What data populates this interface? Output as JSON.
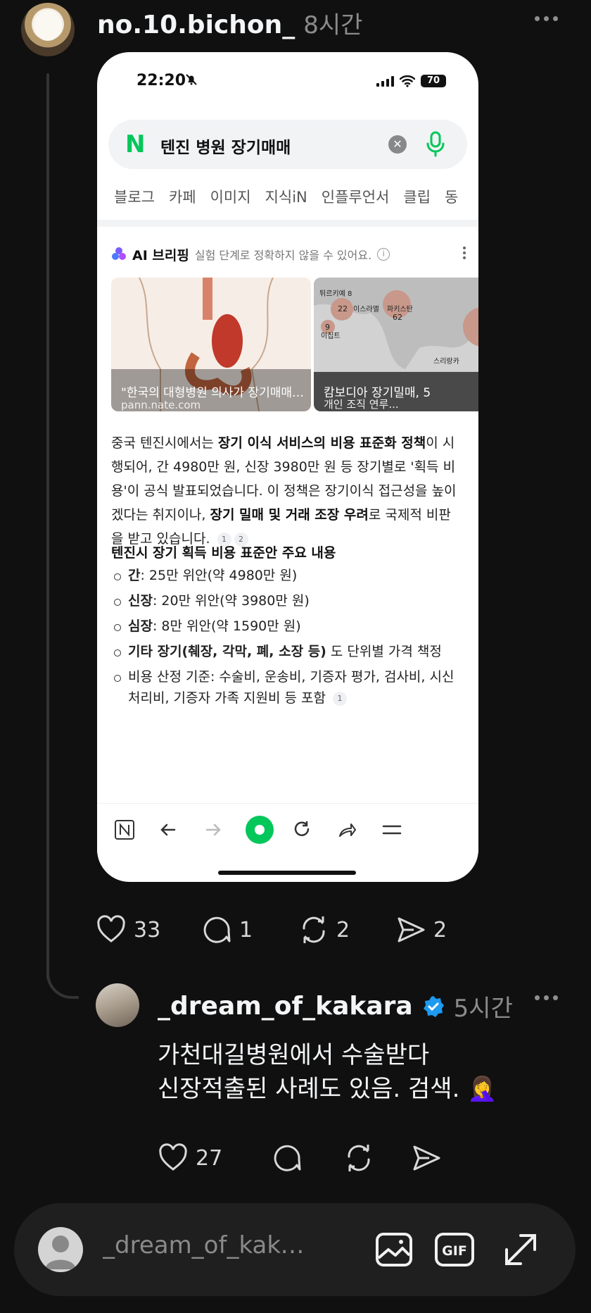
{
  "post": {
    "username": "no.10.bichon_",
    "time": "8시간",
    "likes": "33",
    "comments": "1",
    "reposts": "2",
    "shares": "2"
  },
  "screenshot": {
    "status_time": "22:20",
    "battery": "70",
    "search_query": "텐진 병원 장기매매",
    "tabs": [
      "블로그",
      "카페",
      "이미지",
      "지식iN",
      "인플루언서",
      "클립",
      "동"
    ],
    "ai_title": "AI 브리핑",
    "ai_note": "실험 단계로 정확하지 않을 수 있어요.",
    "image1_caption": "\"한국의 대형병원 의사가 장기매매 ...",
    "image1_source": "pann.nate.com",
    "image2_caption": "캄보디아 장기밀매, 5",
    "image2_source": "개인 조직 연루...",
    "map_labels": [
      "튀르키예 8",
      "22",
      "이스라엘",
      "파키스탄",
      "62",
      "9",
      "이집트",
      "스리랑카"
    ],
    "body_p1": "중국 텐진시에서는 ",
    "body_b1": "장기 이식 서비스의 비용 표준화 정책",
    "body_p2": "이 시행되어, 간 4980만 원, 신장 3980만 원 등 장기별로 '획득 비용'이 공식 발표되었습니다. 이 정책은 장기이식 접근성을 높이겠다는 취지이나, ",
    "body_b2": "장기 밀매 및 거래 조장 우려",
    "body_p3": "로 국제적 비판을 받고 있습니다.",
    "cite1": "1",
    "cite2": "2",
    "subtitle": "텐진시 장기 획득 비용 표준안 주요 내용",
    "bullets": [
      {
        "bold": "간",
        "text": ": 25만 위안(약 4980만 원)"
      },
      {
        "bold": "신장",
        "text": ": 20만 위안(약 3980만 원)"
      },
      {
        "bold": "심장",
        "text": ": 8만 위안(약 1590만 원)"
      },
      {
        "bold": "기타 장기(췌장, 각막, 폐, 소장 등)",
        "text": " 도 단위별 가격 책정"
      },
      {
        "bold": "",
        "text": "비용 산정 기준: 수술비, 운송비, 기증자 평가, 검사비, 시신 처리비, 기증자 가족 지원비 등 포함"
      }
    ],
    "bullet_cite": "1"
  },
  "reply": {
    "username": "_dream_of_kakara",
    "time": "5시간",
    "text_line1": "가천대길병원에서 수술받다",
    "text_line2": "신장적출된 사례도 있음. 검색. 🤦‍♀️",
    "likes": "27"
  },
  "composer": {
    "placeholder": "_dream_of_kakara..."
  },
  "colors": {
    "background": "#101010",
    "naver_green": "#03c75a",
    "verified_blue": "#1d9bf0"
  }
}
